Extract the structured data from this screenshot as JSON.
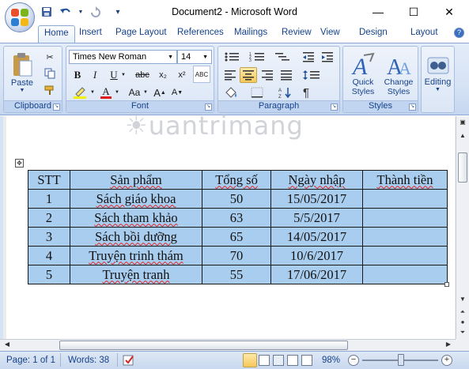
{
  "window": {
    "title": "Document2 - Microsoft Word",
    "minimize": "—",
    "maximize": "☐",
    "close": "✕"
  },
  "qat": {
    "save_icon": "save-icon",
    "undo_icon": "undo-icon",
    "redo_icon": "redo-icon",
    "customize_icon": "customize-icon"
  },
  "tabs": [
    {
      "label": "Home"
    },
    {
      "label": "Insert"
    },
    {
      "label": "Page Layout"
    },
    {
      "label": "References"
    },
    {
      "label": "Mailings"
    },
    {
      "label": "Review"
    },
    {
      "label": "View"
    },
    {
      "label": "Design"
    },
    {
      "label": "Layout"
    }
  ],
  "ribbon": {
    "clipboard": {
      "paste": "Paste",
      "label": "Clipboard"
    },
    "font": {
      "name": "Times New Roman",
      "size": "14",
      "label": "Font",
      "bold": "B",
      "italic": "I",
      "underline": "U",
      "strike": "abc",
      "subscript": "x₂",
      "superscript": "x²",
      "change_case": "Aa",
      "grow": "A",
      "shrink": "A",
      "clear": "ABC"
    },
    "paragraph": {
      "label": "Paragraph",
      "pilcrow": "¶"
    },
    "styles": {
      "quick": "Quick Styles",
      "change": "Change Styles",
      "label": "Styles"
    },
    "editing": {
      "label": "Editing"
    }
  },
  "document": {
    "watermark": "uantrimang",
    "table": {
      "headers": [
        "STT",
        "Sản phẩm",
        "Tổng số",
        "Ngày nhập",
        "Thành tiền"
      ],
      "rows": [
        [
          "1",
          "Sách giáo khoa",
          "50",
          "15/05/2017",
          ""
        ],
        [
          "2",
          "Sách tham khảo",
          "63",
          "5/5/2017",
          ""
        ],
        [
          "3",
          "Sách bồi dưỡng",
          "65",
          "14/05/2017",
          ""
        ],
        [
          "4",
          "Truyện trinh thám",
          "70",
          "10/6/2017",
          ""
        ],
        [
          "5",
          "Truyện tranh",
          "55",
          "17/06/2017",
          ""
        ]
      ]
    }
  },
  "status": {
    "page": "Page: 1 of 1",
    "words": "Words: 38",
    "zoom": "98%"
  },
  "colors": {
    "ribbon": "#d6e3f5",
    "table_fill": "#a9cdee",
    "accent": "#15428b"
  }
}
